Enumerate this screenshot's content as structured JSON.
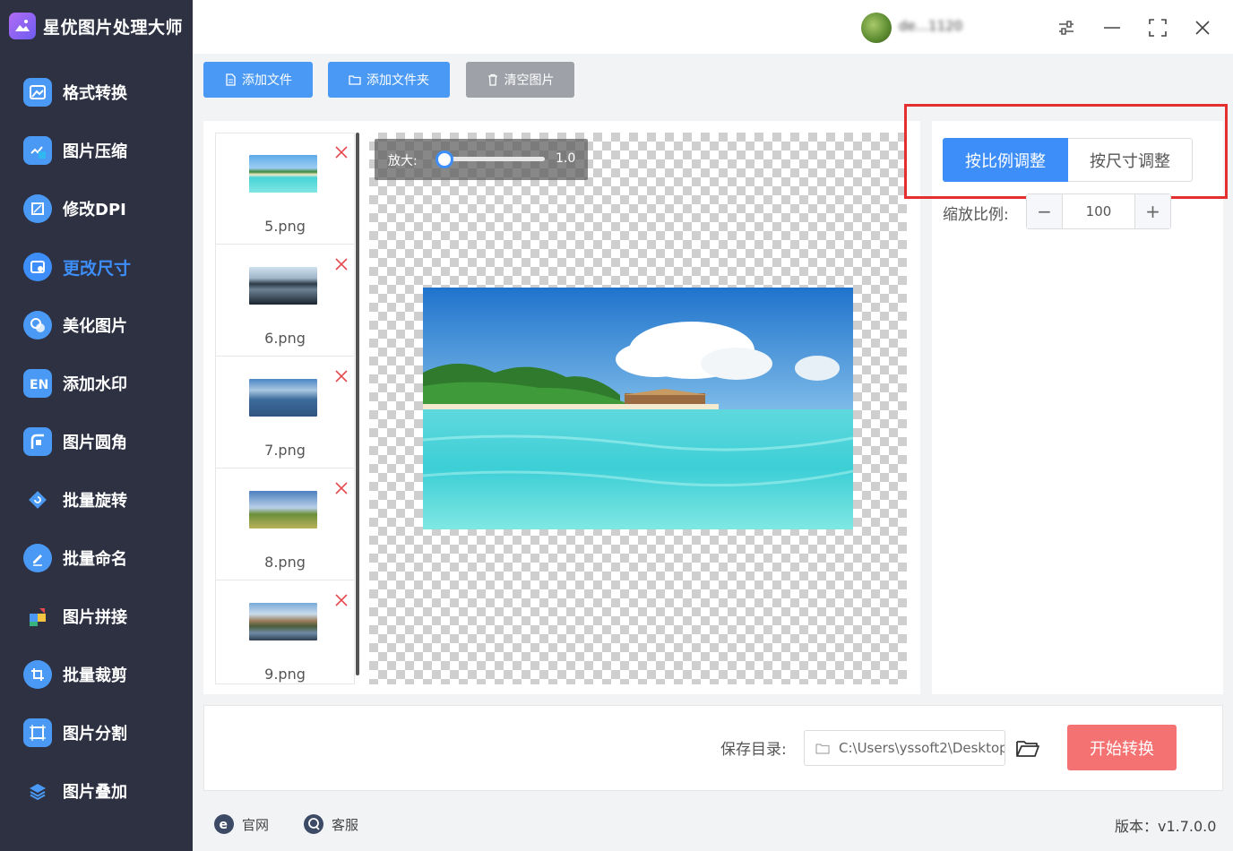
{
  "app": {
    "title": "星优图片处理大师"
  },
  "sidebar": {
    "items": [
      {
        "label": "格式转换",
        "icon": "image-format-icon",
        "color": "#4a9af5"
      },
      {
        "label": "图片压缩",
        "icon": "compress-icon",
        "color": "#4a9af5"
      },
      {
        "label": "修改DPI",
        "icon": "dpi-icon",
        "color": "#4a9af5"
      },
      {
        "label": "更改尺寸",
        "icon": "resize-icon",
        "color": "#3d8ef8",
        "active": true
      },
      {
        "label": "美化图片",
        "icon": "beautify-icon",
        "color": "#4a9af5"
      },
      {
        "label": "添加水印",
        "icon": "watermark-icon",
        "color": "#4a9af5"
      },
      {
        "label": "图片圆角",
        "icon": "round-corner-icon",
        "color": "#4a9af5"
      },
      {
        "label": "批量旋转",
        "icon": "rotate-icon",
        "color": "#4a9af5"
      },
      {
        "label": "批量命名",
        "icon": "rename-icon",
        "color": "#4a9af5"
      },
      {
        "label": "图片拼接",
        "icon": "puzzle-icon",
        "color": "#4a9af5"
      },
      {
        "label": "批量裁剪",
        "icon": "crop-icon",
        "color": "#4a9af5"
      },
      {
        "label": "图片分割",
        "icon": "split-icon",
        "color": "#4a9af5"
      },
      {
        "label": "图片叠加",
        "icon": "layers-icon",
        "color": "#4a9af5"
      }
    ]
  },
  "titlebar": {
    "user_name": "de...1120"
  },
  "toolbar": {
    "add_file": "添加文件",
    "add_folder": "添加文件夹",
    "clear_images": "清空图片"
  },
  "file_list": [
    {
      "name": "5.png"
    },
    {
      "name": "6.png"
    },
    {
      "name": "7.png"
    },
    {
      "name": "8.png"
    },
    {
      "name": "9.png"
    }
  ],
  "preview": {
    "zoom_label": "放大:",
    "zoom_value": "1.0"
  },
  "settings": {
    "mode_ratio": "按比例调整",
    "mode_size": "按尺寸调整",
    "active_mode": "ratio",
    "scale_label": "缩放比例:",
    "scale_value": "100"
  },
  "output": {
    "save_dir_label": "保存目录:",
    "save_dir_value": "C:\\Users\\yssoft2\\Desktop",
    "start_button": "开始转换"
  },
  "footer": {
    "website": "官网",
    "support": "客服",
    "version": "版本：v1.7.0.0"
  },
  "colors": {
    "sidebar_bg": "#2d3142",
    "accent": "#3d8ef8",
    "start_button": "#f47272",
    "highlight_border": "#e52e2e"
  }
}
